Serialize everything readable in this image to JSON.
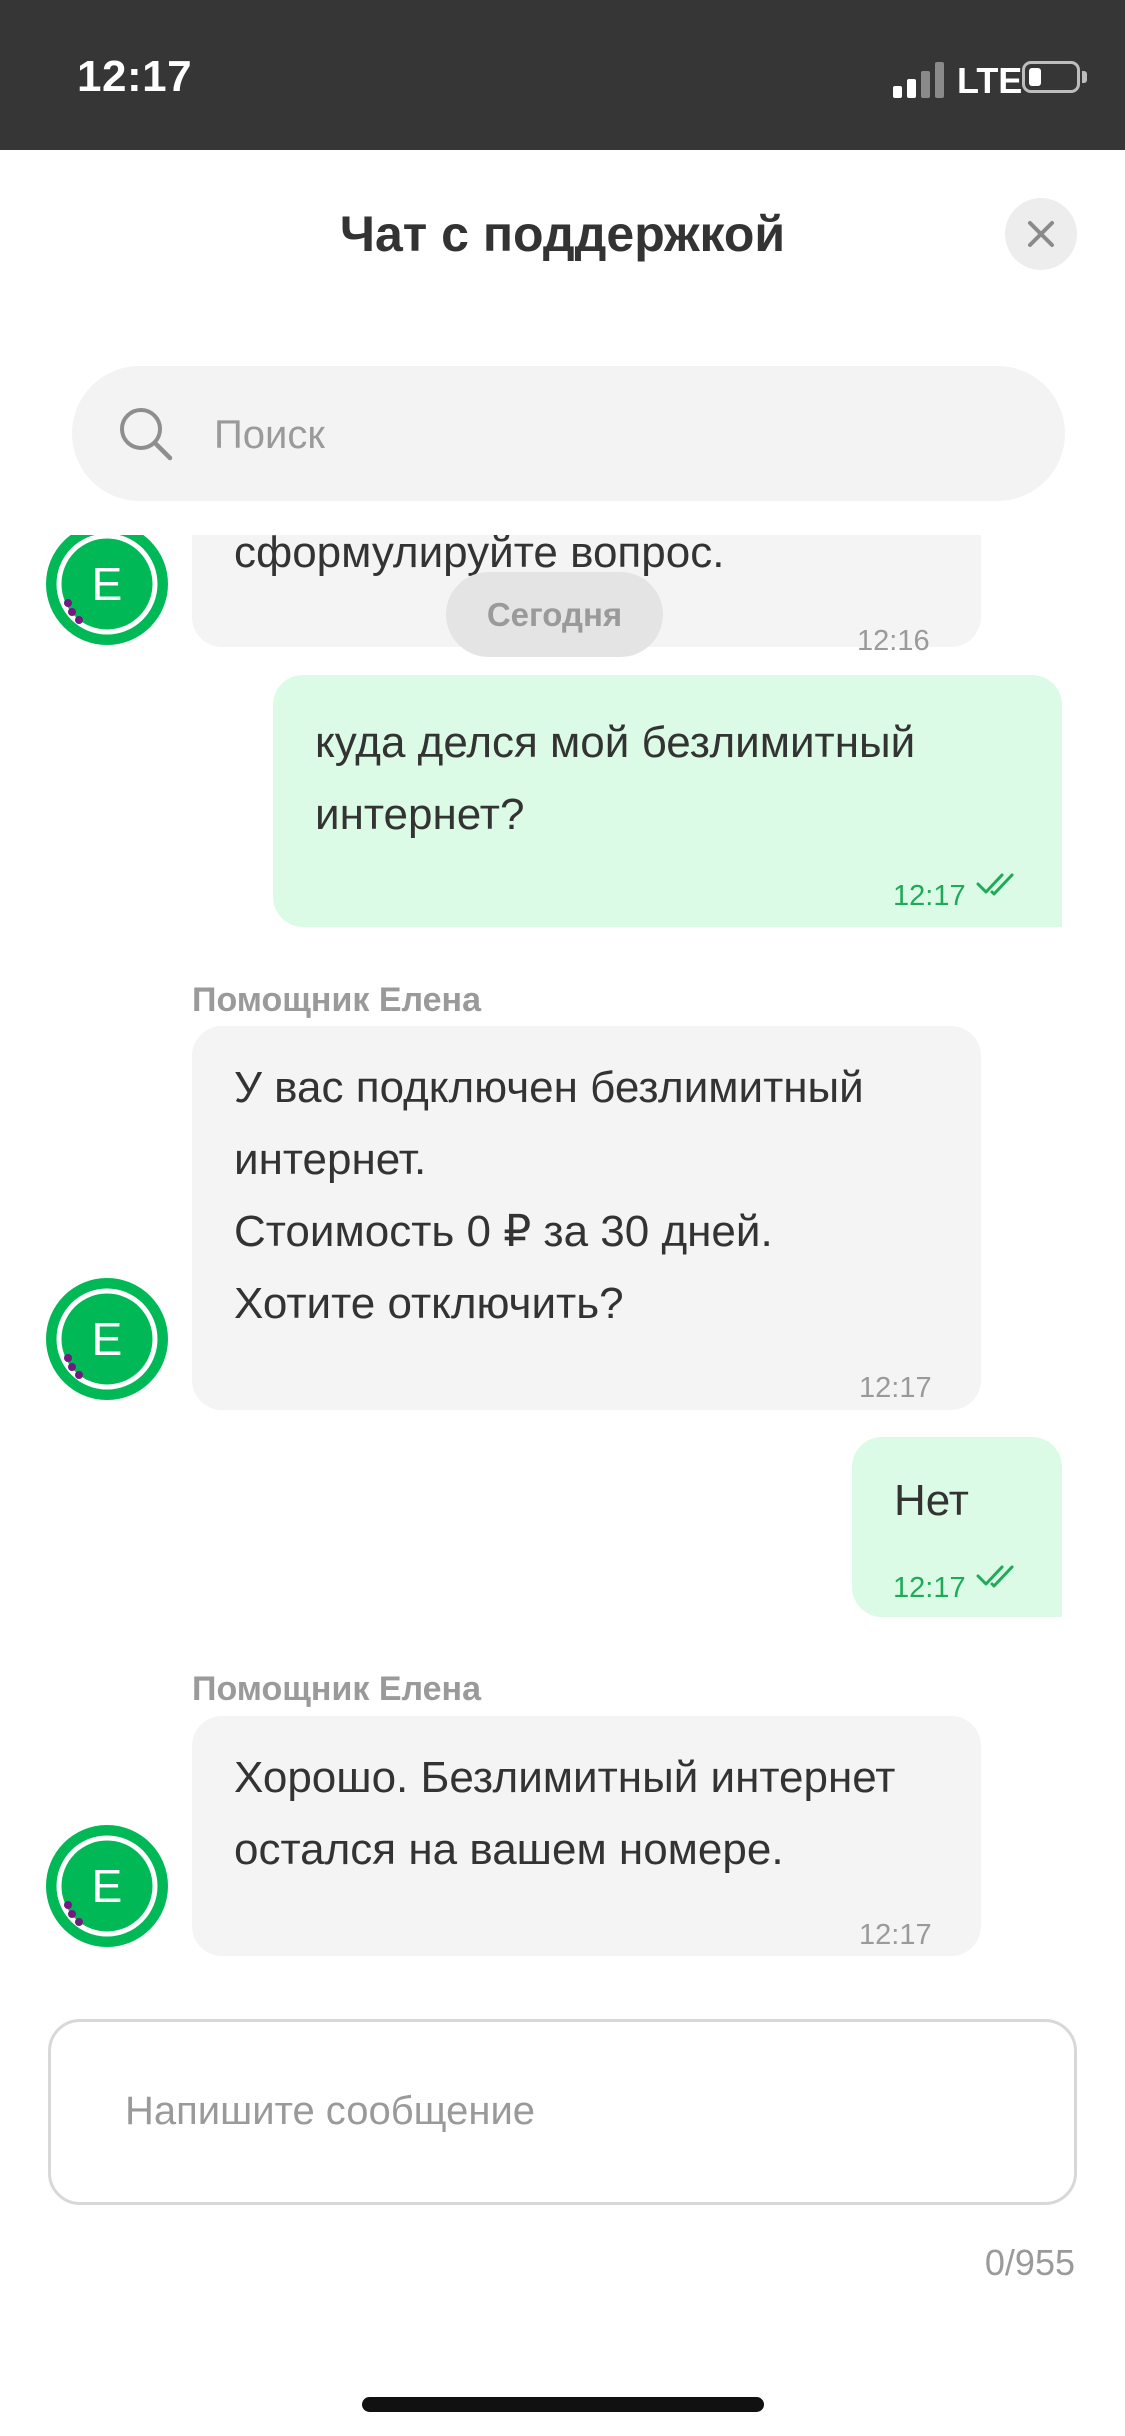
{
  "status_bar": {
    "time": "12:17",
    "network": "LTE"
  },
  "header": {
    "title": "Чат с поддержкой"
  },
  "search": {
    "placeholder": "Поиск"
  },
  "avatar_letter": "E",
  "chat": {
    "date_chip": "Сегодня",
    "messages": [
      {
        "direction": "in",
        "text": "сформулируйте вопрос.",
        "time": "12:16"
      },
      {
        "direction": "out",
        "text": "куда делся мой безлимитный\nинтернет?",
        "time": "12:17"
      },
      {
        "direction": "in",
        "sender": "Помощник Елена",
        "text": "У вас подключен безлимитный\nинтернет.\nСтоимость 0 ₽ за 30 дней.\nХотите отключить?",
        "time": "12:17"
      },
      {
        "direction": "out",
        "text": "Нет",
        "time": "12:17"
      },
      {
        "direction": "in",
        "sender": "Помощник Елена",
        "text": "Хорошо. Безлимитный интернет\nостался на вашем номере.",
        "time": "12:17"
      }
    ]
  },
  "composer": {
    "placeholder": "Напишите сообщение",
    "counter": "0/955"
  },
  "colors": {
    "brand": "#00b956",
    "outgoing_bubble": "#dcfbe6",
    "incoming_bubble": "#f4f4f4",
    "status_bar": "#363636"
  }
}
